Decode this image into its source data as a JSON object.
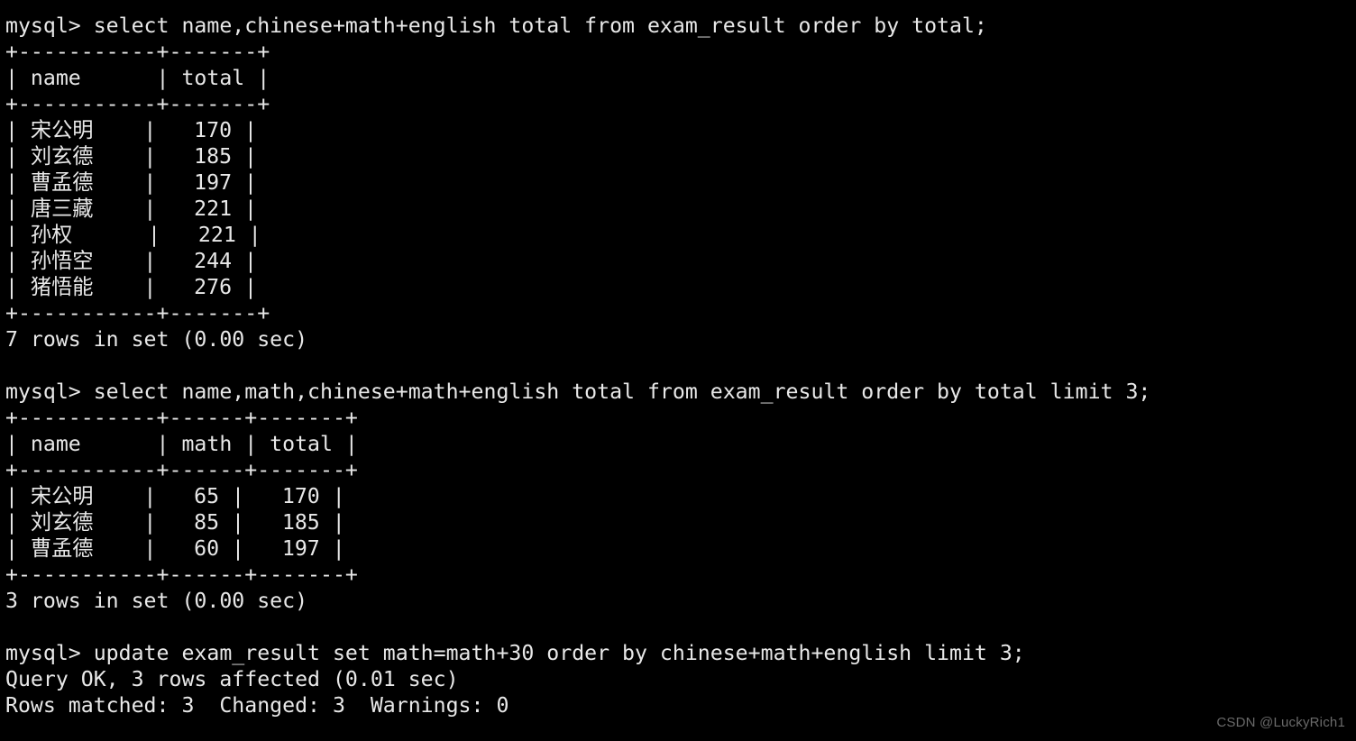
{
  "terminal": {
    "prompt": "mysql>",
    "background_color": "#000000",
    "text_color": "#e8e8e8",
    "watermark": "CSDN @LuckyRich1",
    "lines": [
      "mysql> select name,chinese+math+english total from exam_result order by total;",
      "+-----------+-------+",
      "| name      | total |",
      "+-----------+-------+",
      "| 宋公明    |   170 |",
      "| 刘玄德    |   185 |",
      "| 曹孟德    |   197 |",
      "| 唐三藏    |   221 |",
      "| 孙权      |   221 |",
      "| 孙悟空    |   244 |",
      "| 猪悟能    |   276 |",
      "+-----------+-------+",
      "7 rows in set (0.00 sec)",
      "",
      "mysql> select name,math,chinese+math+english total from exam_result order by total limit 3;",
      "+-----------+------+-------+",
      "| name      | math | total |",
      "+-----------+------+-------+",
      "| 宋公明    |   65 |   170 |",
      "| 刘玄德    |   85 |   185 |",
      "| 曹孟德    |   60 |   197 |",
      "+-----------+------+-------+",
      "3 rows in set (0.00 sec)",
      "",
      "mysql> update exam_result set math=math+30 order by chinese+math+english limit 3;",
      "Query OK, 3 rows affected (0.01 sec)",
      "Rows matched: 3  Changed: 3  Warnings: 0"
    ]
  },
  "queries": [
    {
      "sql": "select name,chinese+math+english total from exam_result order by total;",
      "columns": [
        "name",
        "total"
      ],
      "rows": [
        [
          "宋公明",
          "170"
        ],
        [
          "刘玄德",
          "185"
        ],
        [
          "曹孟德",
          "197"
        ],
        [
          "唐三藏",
          "221"
        ],
        [
          "孙权",
          "221"
        ],
        [
          "孙悟空",
          "244"
        ],
        [
          "猪悟能",
          "276"
        ]
      ],
      "status": "7 rows in set (0.00 sec)"
    },
    {
      "sql": "select name,math,chinese+math+english total from exam_result order by total limit 3;",
      "columns": [
        "name",
        "math",
        "total"
      ],
      "rows": [
        [
          "宋公明",
          "65",
          "170"
        ],
        [
          "刘玄德",
          "85",
          "185"
        ],
        [
          "曹孟德",
          "60",
          "197"
        ]
      ],
      "status": "3 rows in set (0.00 sec)"
    },
    {
      "sql": "update exam_result set math=math+30 order by chinese+math+english limit 3;",
      "columns": [],
      "rows": [],
      "status": "Query OK, 3 rows affected (0.01 sec)",
      "status2": "Rows matched: 3  Changed: 3  Warnings: 0"
    }
  ]
}
